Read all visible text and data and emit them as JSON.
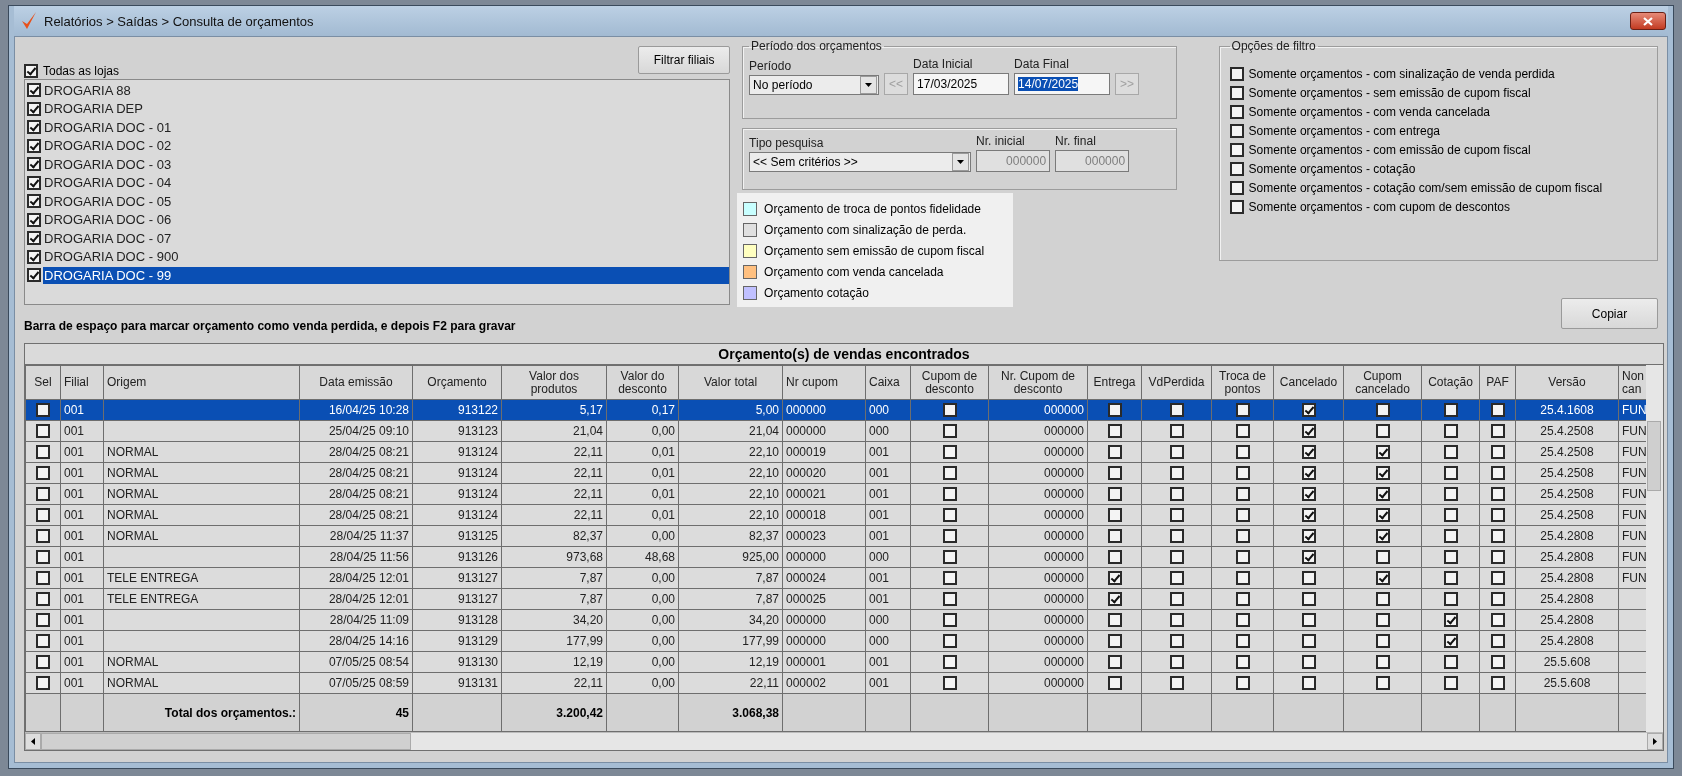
{
  "window": {
    "title": "Relatórios > Saídas > Consulta de orçamentos"
  },
  "stores": {
    "all_label": "Todas as lojas",
    "all_checked": true,
    "filter_button": "Filtrar filiais",
    "items": [
      {
        "label": "DROGARIA 88",
        "checked": true,
        "selected": false
      },
      {
        "label": "DROGARIA DEP",
        "checked": true,
        "selected": false
      },
      {
        "label": "DROGARIA DOC - 01",
        "checked": true,
        "selected": false
      },
      {
        "label": "DROGARIA DOC - 02",
        "checked": true,
        "selected": false
      },
      {
        "label": "DROGARIA DOC - 03",
        "checked": true,
        "selected": false
      },
      {
        "label": "DROGARIA DOC - 04",
        "checked": true,
        "selected": false
      },
      {
        "label": "DROGARIA DOC - 05",
        "checked": true,
        "selected": false
      },
      {
        "label": "DROGARIA DOC - 06",
        "checked": true,
        "selected": false
      },
      {
        "label": "DROGARIA DOC - 07",
        "checked": true,
        "selected": false
      },
      {
        "label": "DROGARIA DOC - 900",
        "checked": true,
        "selected": false
      },
      {
        "label": "DROGARIA DOC - 99",
        "checked": true,
        "selected": true
      }
    ]
  },
  "period": {
    "title": "Período dos orçamentos",
    "period_label": "Período",
    "period_value": "No período",
    "prev_button": "<<",
    "next_button": ">>",
    "nav_disabled": true,
    "start_label": "Data Inicial",
    "start_value": "17/03/2025",
    "end_label": "Data Final",
    "end_value": "14/07/2025",
    "end_selected": true
  },
  "search": {
    "type_label": "Tipo pesquisa",
    "type_value": "<< Sem critérios >>",
    "start_label": "Nr. inicial",
    "start_value": "000000",
    "end_label": "Nr. final",
    "end_value": "000000",
    "numbers_disabled": true
  },
  "legend": [
    {
      "label": "Orçamento de troca de pontos fidelidade",
      "color": "#c8ffff"
    },
    {
      "label": "Orçamento com sinalização de perda.",
      "color": "#e0e0e0"
    },
    {
      "label": "Orçamento sem emissão de cupom fiscal",
      "color": "#ffffc0"
    },
    {
      "label": "Orçamento com venda cancelada",
      "color": "#ffc080"
    },
    {
      "label": "Orçamento cotação",
      "color": "#c0c0ff"
    }
  ],
  "filter_options": {
    "title": "Opções de filtro",
    "items": [
      {
        "label": "Somente orçamentos - com sinalização de venda perdida",
        "checked": false
      },
      {
        "label": "Somente orçamentos - sem emissão de cupom fiscal",
        "checked": false
      },
      {
        "label": "Somente orçamentos - com venda cancelada",
        "checked": false
      },
      {
        "label": "Somente orçamentos - com entrega",
        "checked": false
      },
      {
        "label": "Somente orçamentos - com emissão de cupom fiscal",
        "checked": false
      },
      {
        "label": "Somente orçamentos - cotação",
        "checked": false
      },
      {
        "label": "Somente orçamentos - cotação com/sem emissão de cupom fiscal",
        "checked": false
      },
      {
        "label": "Somente orçamentos - com cupom de descontos",
        "checked": false
      }
    ]
  },
  "hint": "Barra de espaço para marcar orçamento como venda perdida, e depois F2 para gravar",
  "copy_button": "Copiar",
  "table": {
    "title": "Orçamento(s) de vendas encontrados",
    "columns": [
      {
        "label": "Sel",
        "kind": "check"
      },
      {
        "label": "Filial",
        "kind": "text"
      },
      {
        "label": "Origem",
        "kind": "text"
      },
      {
        "label": "Data emissão",
        "kind": "number"
      },
      {
        "label": "Orçamento",
        "kind": "number"
      },
      {
        "label": "Valor dos produtos",
        "kind": "number"
      },
      {
        "label": "Valor do desconto",
        "kind": "number"
      },
      {
        "label": "Valor total",
        "kind": "number"
      },
      {
        "label": "Nr cupom",
        "kind": "text"
      },
      {
        "label": "Caixa",
        "kind": "text"
      },
      {
        "label": "Cupom de desconto",
        "kind": "check"
      },
      {
        "label": "Nr. Cupom de desconto",
        "kind": "number"
      },
      {
        "label": "Entrega",
        "kind": "check"
      },
      {
        "label": "VdPerdida",
        "kind": "check"
      },
      {
        "label": "Troca de pontos",
        "kind": "check"
      },
      {
        "label": "Cancelado",
        "kind": "check"
      },
      {
        "label": "Cupom cancelado",
        "kind": "check"
      },
      {
        "label": "Cotação",
        "kind": "check"
      },
      {
        "label": "PAF",
        "kind": "check"
      },
      {
        "label": "Versão",
        "kind": "code"
      },
      {
        "label": "Non can",
        "kind": "text"
      }
    ],
    "rows": [
      {
        "selected": true,
        "cells": [
          false,
          "001",
          null,
          "16/04/25 10:28",
          "913122",
          "5,17",
          "0,17",
          "5,00",
          "000000",
          "000",
          false,
          "000000",
          false,
          false,
          false,
          true,
          false,
          false,
          false,
          "25.4.1608",
          "FUN"
        ]
      },
      {
        "selected": false,
        "cells": [
          false,
          "001",
          null,
          "25/04/25 09:10",
          "913123",
          "21,04",
          "0,00",
          "21,04",
          "000000",
          "000",
          false,
          "000000",
          false,
          false,
          false,
          true,
          false,
          false,
          false,
          "25.4.2508",
          "FUN"
        ]
      },
      {
        "selected": false,
        "cells": [
          false,
          "001",
          "NORMAL",
          "28/04/25 08:21",
          "913124",
          "22,11",
          "0,01",
          "22,10",
          "000019",
          "001",
          false,
          "000000",
          false,
          false,
          false,
          true,
          true,
          false,
          false,
          "25.4.2508",
          "FUN"
        ]
      },
      {
        "selected": false,
        "cells": [
          false,
          "001",
          "NORMAL",
          "28/04/25 08:21",
          "913124",
          "22,11",
          "0,01",
          "22,10",
          "000020",
          "001",
          false,
          "000000",
          false,
          false,
          false,
          true,
          true,
          false,
          false,
          "25.4.2508",
          "FUN"
        ]
      },
      {
        "selected": false,
        "cells": [
          false,
          "001",
          "NORMAL",
          "28/04/25 08:21",
          "913124",
          "22,11",
          "0,01",
          "22,10",
          "000021",
          "001",
          false,
          "000000",
          false,
          false,
          false,
          true,
          true,
          false,
          false,
          "25.4.2508",
          "FUN"
        ]
      },
      {
        "selected": false,
        "cells": [
          false,
          "001",
          "NORMAL",
          "28/04/25 08:21",
          "913124",
          "22,11",
          "0,01",
          "22,10",
          "000018",
          "001",
          false,
          "000000",
          false,
          false,
          false,
          true,
          true,
          false,
          false,
          "25.4.2508",
          "FUN"
        ]
      },
      {
        "selected": false,
        "cells": [
          false,
          "001",
          "NORMAL",
          "28/04/25 11:37",
          "913125",
          "82,37",
          "0,00",
          "82,37",
          "000023",
          "001",
          false,
          "000000",
          false,
          false,
          false,
          true,
          true,
          false,
          false,
          "25.4.2808",
          "FUN"
        ]
      },
      {
        "selected": false,
        "cells": [
          false,
          "001",
          null,
          "28/04/25 11:56",
          "913126",
          "973,68",
          "48,68",
          "925,00",
          "000000",
          "000",
          false,
          "000000",
          false,
          false,
          false,
          true,
          false,
          false,
          false,
          "25.4.2808",
          "FUN"
        ]
      },
      {
        "selected": false,
        "cells": [
          false,
          "001",
          "TELE ENTREGA",
          "28/04/25 12:01",
          "913127",
          "7,87",
          "0,00",
          "7,87",
          "000024",
          "001",
          false,
          "000000",
          true,
          false,
          false,
          false,
          true,
          false,
          false,
          "25.4.2808",
          "FUN"
        ]
      },
      {
        "selected": false,
        "cells": [
          false,
          "001",
          "TELE ENTREGA",
          "28/04/25 12:01",
          "913127",
          "7,87",
          "0,00",
          "7,87",
          "000025",
          "001",
          false,
          "000000",
          true,
          false,
          false,
          false,
          false,
          false,
          false,
          "25.4.2808",
          null
        ]
      },
      {
        "selected": false,
        "cells": [
          false,
          "001",
          null,
          "28/04/25 11:09",
          "913128",
          "34,20",
          "0,00",
          "34,20",
          "000000",
          "000",
          false,
          "000000",
          false,
          false,
          false,
          false,
          false,
          true,
          false,
          "25.4.2808",
          null
        ]
      },
      {
        "selected": false,
        "cells": [
          false,
          "001",
          null,
          "28/04/25 14:16",
          "913129",
          "177,99",
          "0,00",
          "177,99",
          "000000",
          "000",
          false,
          "000000",
          false,
          false,
          false,
          false,
          false,
          true,
          false,
          "25.4.2808",
          null
        ]
      },
      {
        "selected": false,
        "cells": [
          false,
          "001",
          "NORMAL",
          "07/05/25 08:54",
          "913130",
          "12,19",
          "0,00",
          "12,19",
          "000001",
          "001",
          false,
          "000000",
          false,
          false,
          false,
          false,
          false,
          false,
          false,
          "25.5.608",
          null
        ]
      },
      {
        "selected": false,
        "cells": [
          false,
          "001",
          "NORMAL",
          "07/05/25 08:59",
          "913131",
          "22,11",
          "0,00",
          "22,11",
          "000002",
          "001",
          false,
          "000000",
          false,
          false,
          false,
          false,
          false,
          false,
          false,
          "25.5.608",
          null
        ]
      }
    ],
    "totals": {
      "cells": [
        null,
        null,
        "Total dos orçamentos.:",
        "45",
        null,
        "3.200,42",
        null,
        "3.068,38"
      ]
    }
  }
}
